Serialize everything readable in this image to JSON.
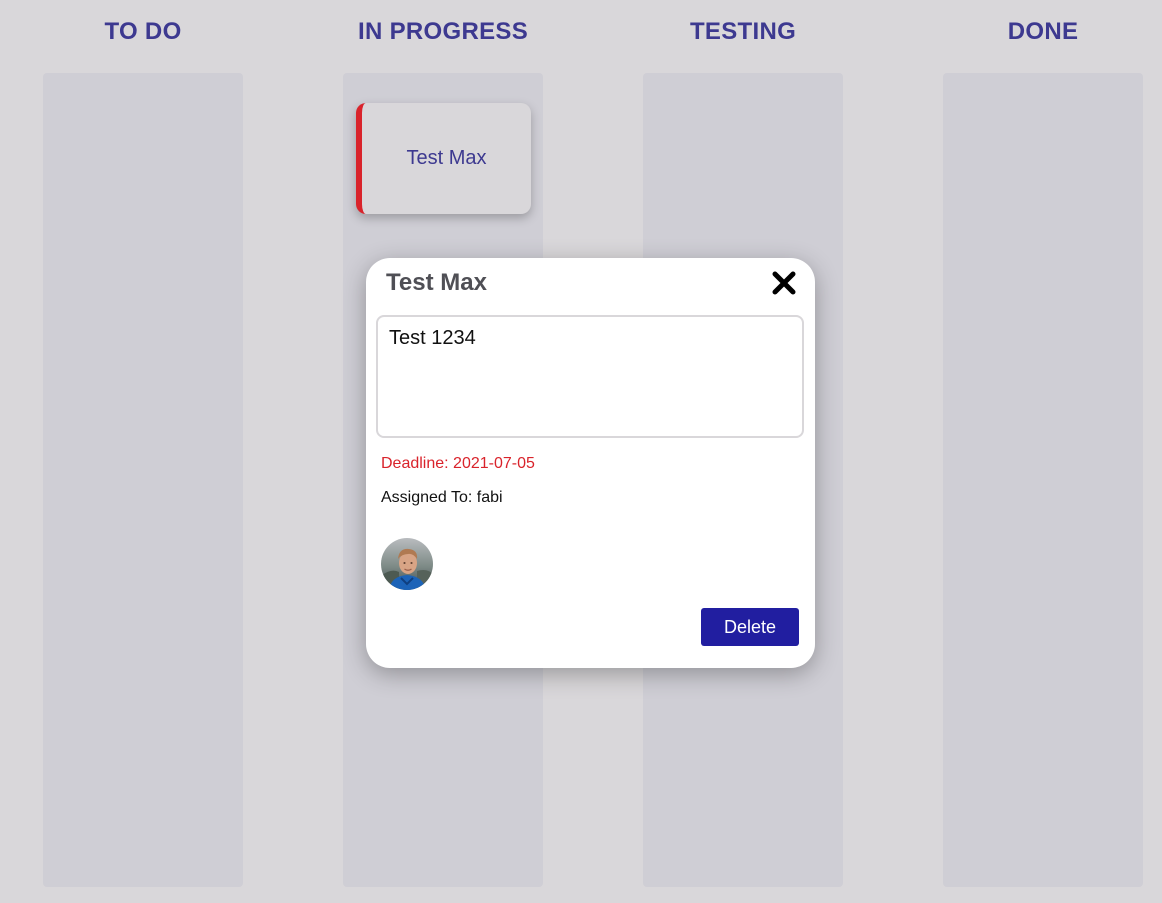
{
  "board": {
    "columns": [
      {
        "title": "TO DO"
      },
      {
        "title": "IN PROGRESS"
      },
      {
        "title": "TESTING"
      },
      {
        "title": "DONE"
      }
    ]
  },
  "card": {
    "title": "Test Max",
    "accent_color": "#d9232b"
  },
  "modal": {
    "title": "Test Max",
    "description": "Test 1234",
    "deadline": "Deadline: 2021-07-05",
    "assigned": "Assigned To: fabi",
    "delete_label": "Delete",
    "close_icon": "close-icon"
  },
  "colors": {
    "heading": "#3d3990",
    "column_bg": "#cfced5",
    "page_bg": "#d9d7da",
    "deadline": "#d9232b",
    "button": "#211ea0"
  }
}
